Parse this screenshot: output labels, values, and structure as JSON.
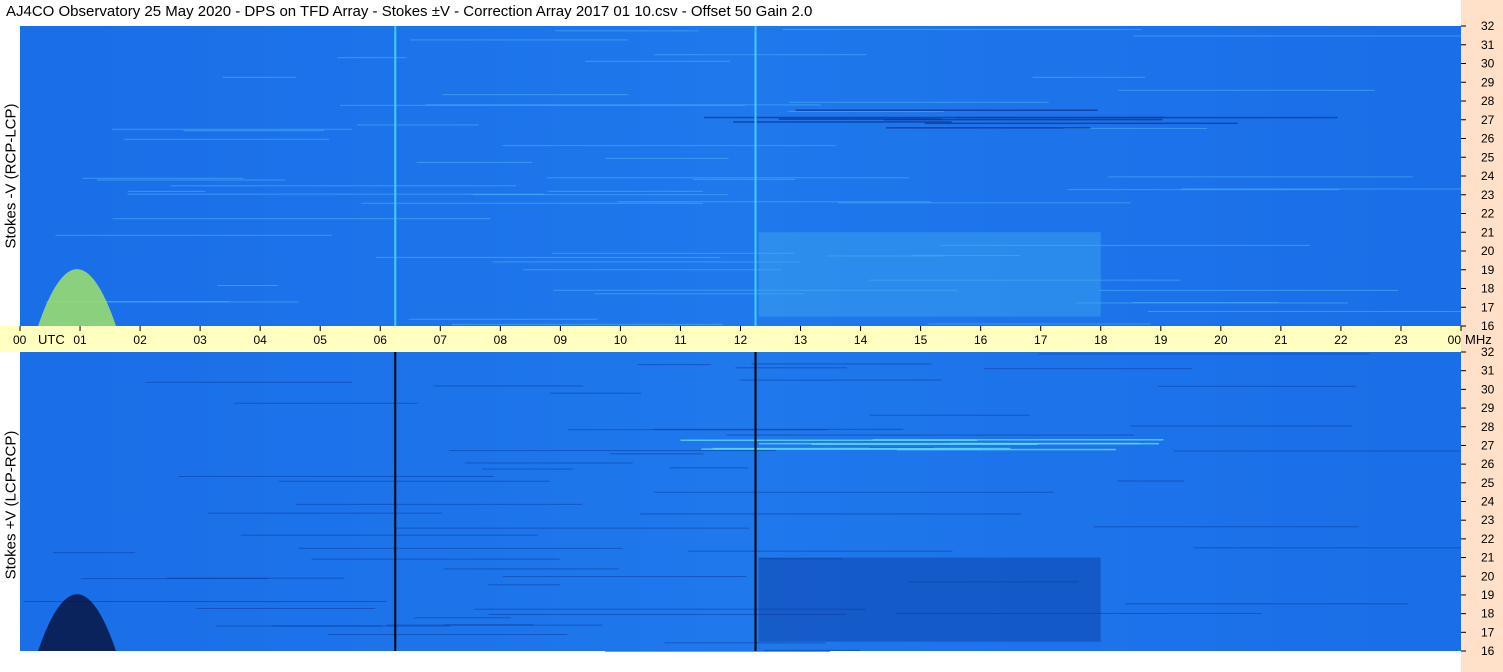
{
  "chart_data": {
    "type": "heatmap",
    "title": "AJ4CO Observatory  25 May 2020  -  DPS on TFD Array  -  Stokes ±V  -  Correction Array 2017 01 10.csv  -  Offset 50  Gain 2.0",
    "x_ticks": [
      "00",
      "01",
      "02",
      "03",
      "04",
      "05",
      "06",
      "07",
      "08",
      "09",
      "10",
      "11",
      "12",
      "13",
      "14",
      "15",
      "16",
      "17",
      "18",
      "19",
      "20",
      "21",
      "22",
      "23",
      "00"
    ],
    "x_unit": "UTC",
    "y_unit": "MHz",
    "y_ticks": [
      16,
      17,
      18,
      19,
      20,
      21,
      22,
      23,
      24,
      25,
      26,
      27,
      28,
      29,
      30,
      31,
      32
    ],
    "xlim": [
      0,
      24
    ],
    "ylim": [
      16,
      32
    ],
    "panels": [
      {
        "ylabel": "Stokes -V (RCP-LCP)",
        "base_color": "#1a6ee8",
        "features": [
          {
            "t": [
              0.3,
              1.6
            ],
            "f": [
              16,
              21
            ],
            "color": "#a8e860",
            "kind": "burst"
          },
          {
            "t": [
              12.3,
              18.0
            ],
            "f": [
              16.5,
              21
            ],
            "color": "#3fa8f0",
            "kind": "region"
          },
          {
            "t": [
              11.0,
              24.0
            ],
            "f": [
              26.6,
              27.6
            ],
            "color": "#0e3a9a",
            "kind": "band"
          },
          {
            "t": [
              6.25,
              6.25
            ],
            "f": [
              16,
              32
            ],
            "color": "#3fd0f0",
            "kind": "line"
          },
          {
            "t": [
              12.25,
              12.25
            ],
            "f": [
              16,
              32
            ],
            "color": "#3fd0f0",
            "kind": "line"
          }
        ]
      },
      {
        "ylabel": "Stokes +V (LCP-RCP)",
        "base_color": "#1a6ee8",
        "features": [
          {
            "t": [
              0.3,
              1.6
            ],
            "f": [
              16,
              21
            ],
            "color": "#08103a",
            "kind": "burst"
          },
          {
            "t": [
              12.3,
              18.0
            ],
            "f": [
              16.5,
              21
            ],
            "color": "#0c3aa0",
            "kind": "region"
          },
          {
            "t": [
              11.0,
              24.0
            ],
            "f": [
              26.6,
              27.6
            ],
            "color": "#60d8f0",
            "kind": "band"
          },
          {
            "t": [
              6.25,
              6.25
            ],
            "f": [
              16,
              32
            ],
            "color": "#000000",
            "kind": "line"
          },
          {
            "t": [
              12.25,
              12.25
            ],
            "f": [
              16,
              32
            ],
            "color": "#000000",
            "kind": "line"
          }
        ]
      }
    ]
  }
}
